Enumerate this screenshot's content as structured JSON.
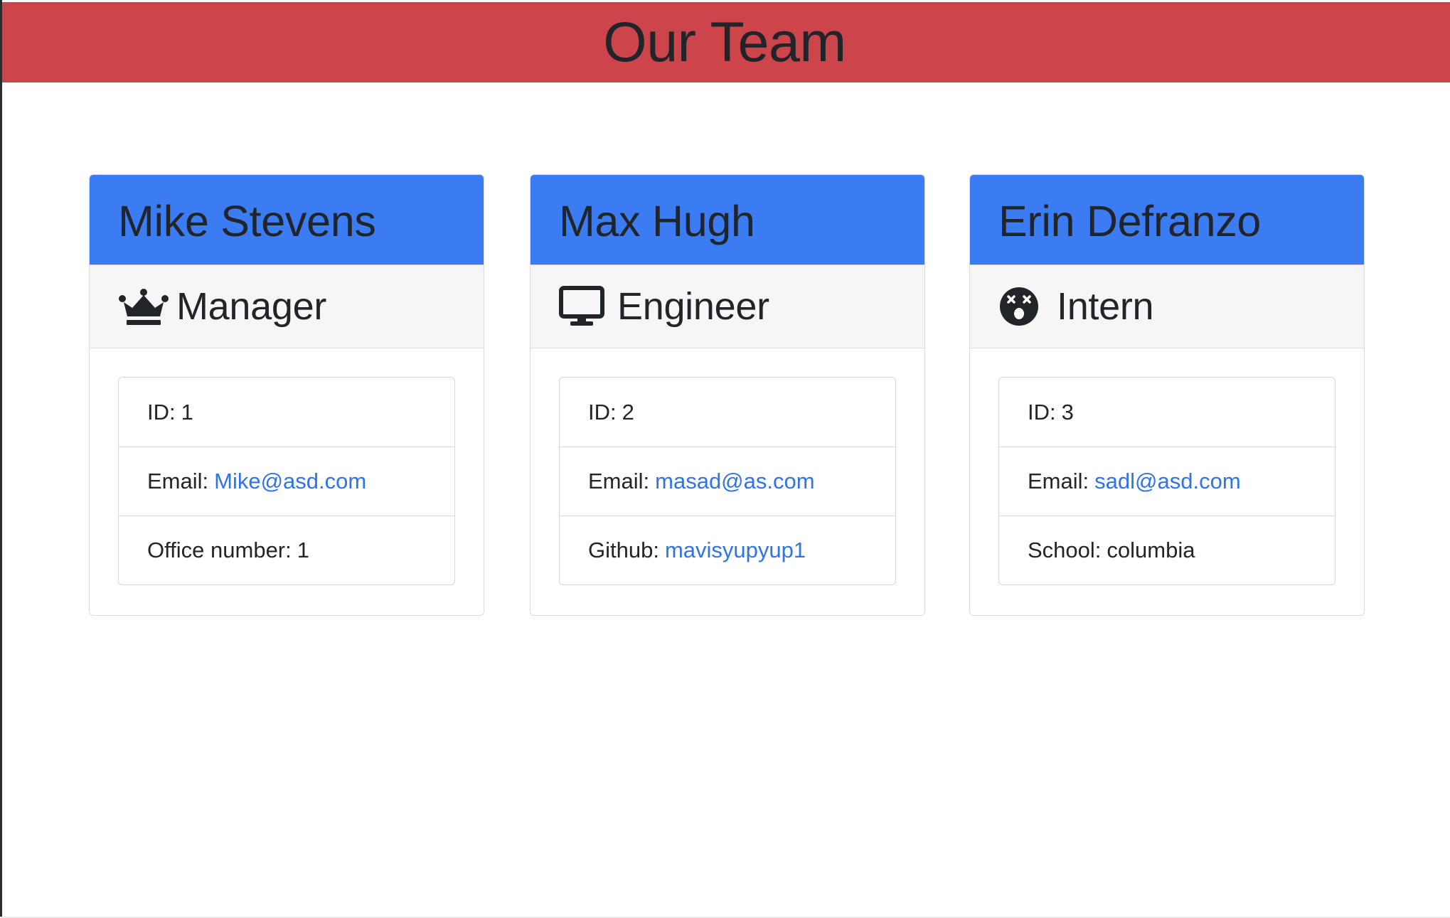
{
  "page": {
    "title": "Our Team"
  },
  "colors": {
    "banner": "#cc454b",
    "card_header": "#3b7cf2",
    "link": "#2f74e6",
    "role_bg": "#f6f6f6"
  },
  "team": [
    {
      "name": "Mike Stevens",
      "role": "Manager",
      "role_icon": "crown-icon",
      "id_label": "ID:",
      "id": "1",
      "email_label": "Email:",
      "email": "Mike@asd.com",
      "extra_label": "Office number:",
      "extra_value": "1"
    },
    {
      "name": "Max Hugh",
      "role": "Engineer",
      "role_icon": "desktop-icon",
      "id_label": "ID:",
      "id": "2",
      "email_label": "Email:",
      "email": "masad@as.com",
      "extra_label": "Github:",
      "extra_value": "mavisyupyup1"
    },
    {
      "name": "Erin Defranzo",
      "role": "Intern",
      "role_icon": "dizzy-face-icon",
      "id_label": "ID:",
      "id": "3",
      "email_label": "Email:",
      "email": "sadl@asd.com",
      "extra_label": "School:",
      "extra_value": "columbia"
    }
  ]
}
